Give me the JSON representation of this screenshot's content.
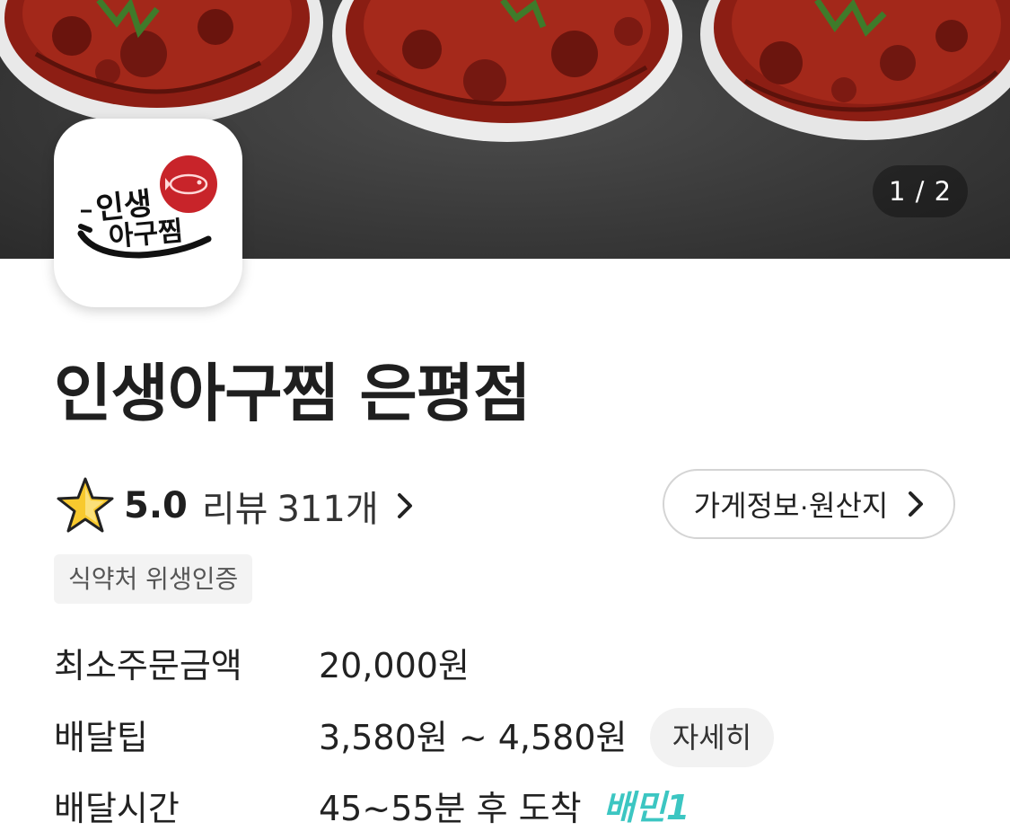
{
  "hero": {
    "page_indicator": "1 / 2"
  },
  "store": {
    "name": "인생아구찜 은평점",
    "rating": "5.0",
    "review_label": "리뷰",
    "review_count": "311개",
    "info_button_label": "가게정보·원산지",
    "badge": "식약처 위생인증"
  },
  "details": {
    "min_order_label": "최소주문금액",
    "min_order_value": "20,000원",
    "delivery_tip_label": "배달팁",
    "delivery_tip_value": "3,580원 ~ 4,580원",
    "delivery_tip_detail_label": "자세히",
    "delivery_time_label": "배달시간",
    "delivery_time_value": "45~55분 후 도착",
    "delivery_badge_text": "배민1"
  },
  "logo": {
    "text_line1": "인생",
    "text_line2": "아구찜"
  },
  "colors": {
    "badge_teal": "#3cc6c2",
    "badge_gold": "#f0b400",
    "logo_red": "#c8242a"
  },
  "icons": {
    "rating": "star-icon",
    "chevron": "chevron-right-icon"
  }
}
